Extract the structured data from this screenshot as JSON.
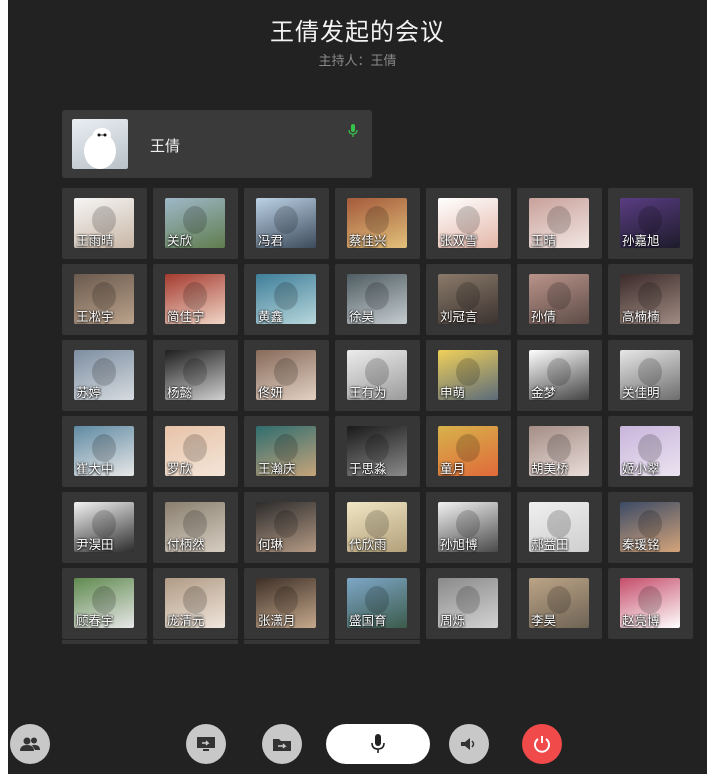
{
  "meeting": {
    "title": "王倩发起的会议",
    "host_line": "主持人：王倩"
  },
  "host": {
    "name": "王倩",
    "mic_color": "#39c24a"
  },
  "participants": [
    "王雨晴",
    "关欣",
    "冯君",
    "蔡佳兴",
    "张双雪",
    "王晴",
    "孙嘉旭",
    "王凇宇",
    "简佳宁",
    "黄鑫",
    "徐昊",
    "刘冠言",
    "孙倩",
    "高楠楠",
    "苏婷",
    "杨懿",
    "佟妍",
    "王有为",
    "申萌",
    "金梦",
    "关佳明",
    "崔大中",
    "罗欣",
    "王瀚庆",
    "于思淼",
    "童月",
    "胡美桥",
    "姬小翠",
    "尹淏田",
    "付柄然",
    "何琳",
    "代欣雨",
    "孙旭博",
    "郝益田",
    "秦瑗铭",
    "顾春宇",
    "庞清元",
    "张潇月",
    "盛国育",
    "周烁",
    "李昊",
    "赵亮博"
  ],
  "toolbar": {
    "end_color": "#f04a4a",
    "icons": [
      "participants-icon",
      "screen-share-icon",
      "file-share-icon",
      "microphone-icon",
      "speaker-icon",
      "power-icon"
    ]
  }
}
